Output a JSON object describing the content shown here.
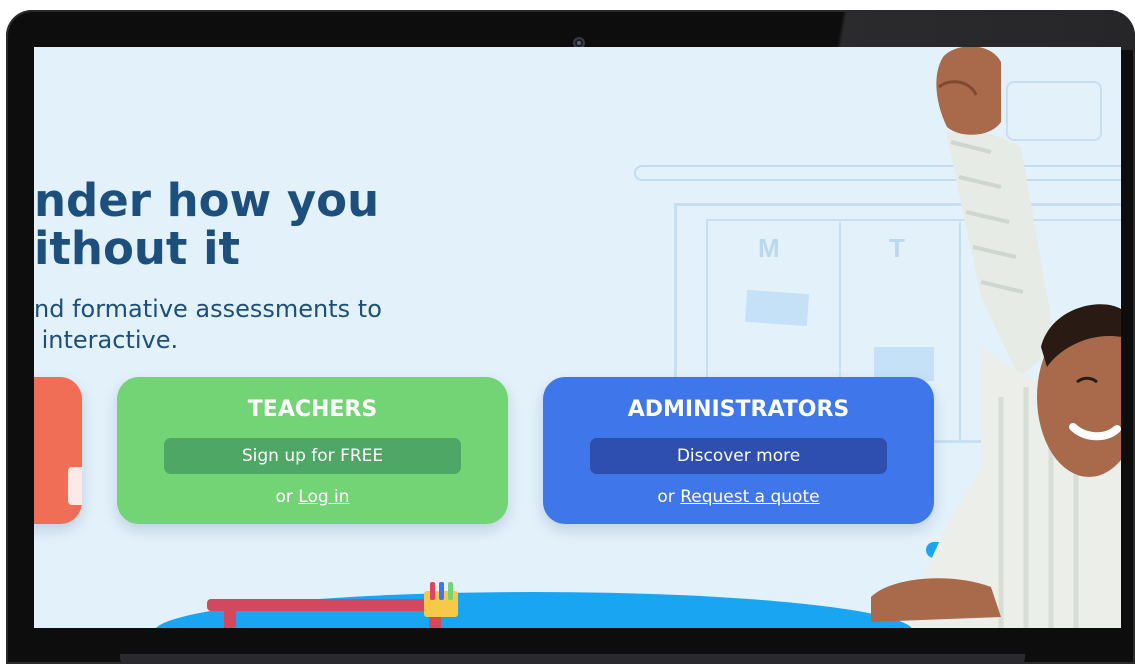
{
  "hero": {
    "title_line1": "nder how you",
    "title_line2": "ithout it",
    "subtitle_line1": "nd formative assessments to",
    "subtitle_line2": " interactive."
  },
  "board_letters": [
    "M",
    "T"
  ],
  "cards": {
    "teachers": {
      "title": "TEACHERS",
      "button": "Sign up for FREE",
      "alt_prefix": "or ",
      "alt_link": "Log in"
    },
    "administrators": {
      "title": "ADMINISTRATORS",
      "button": "Discover more",
      "alt_prefix": "or ",
      "alt_link": "Request a quote"
    }
  },
  "colors": {
    "background": "#e3f1fb",
    "headline": "#1d4f7d",
    "teachers_card": "#73d476",
    "teachers_button": "#4fa765",
    "administrators_card": "#3f77ea",
    "administrators_button": "#2f4fb0",
    "students_card": "#f06e55"
  }
}
